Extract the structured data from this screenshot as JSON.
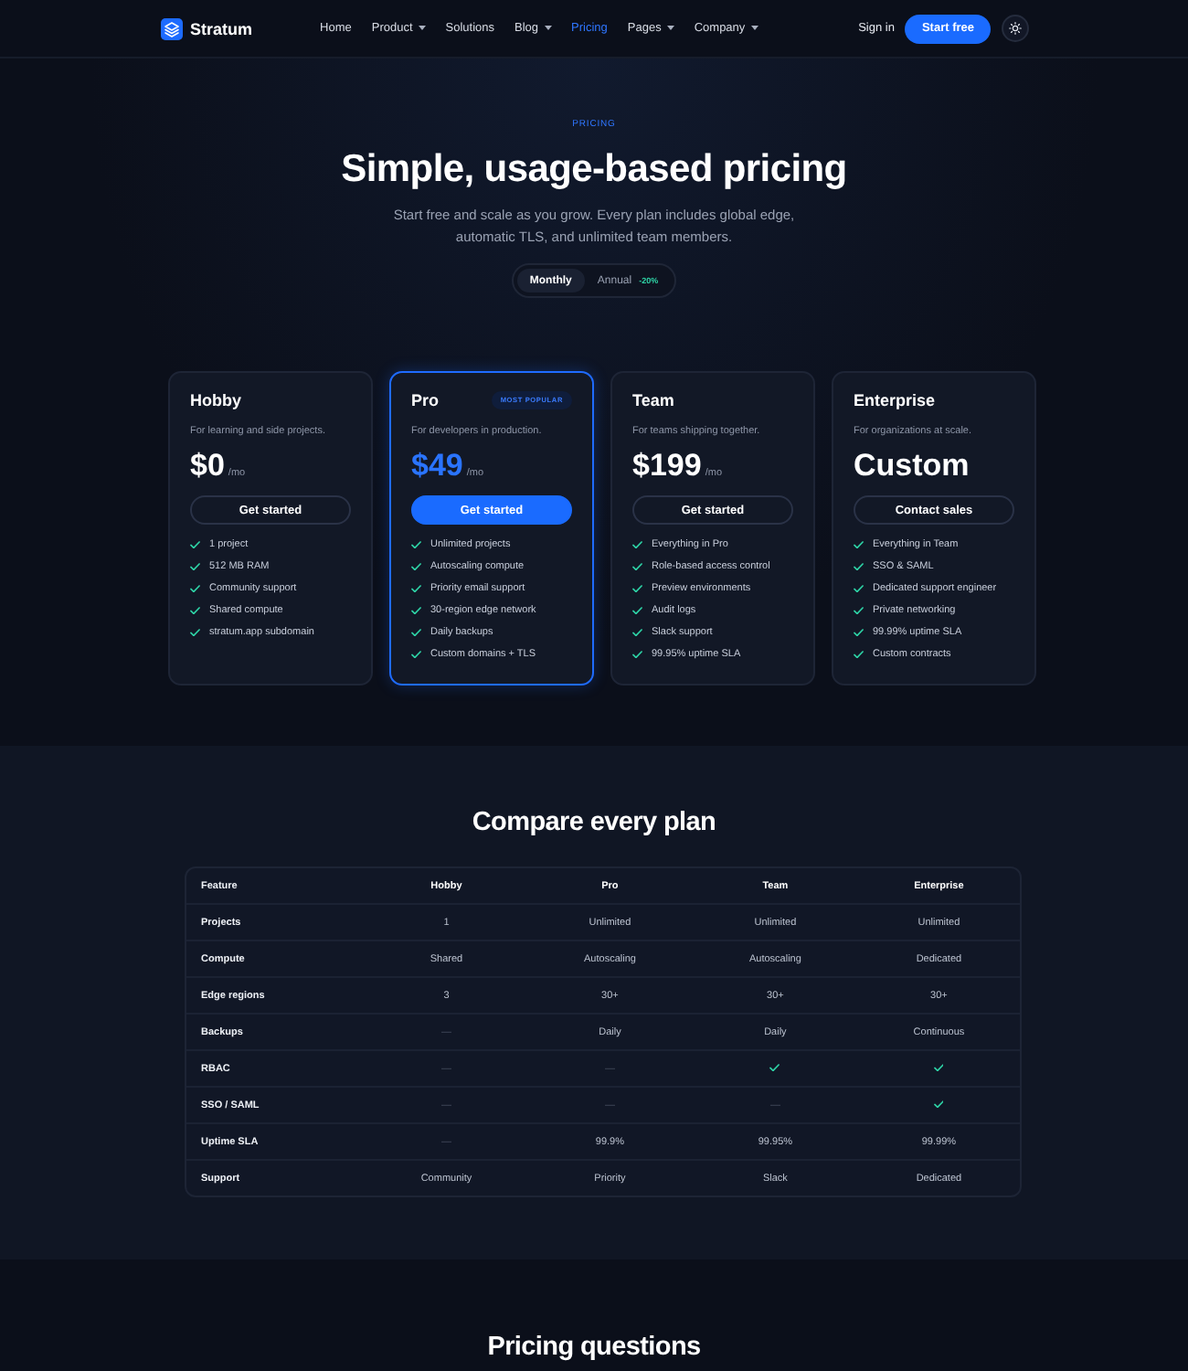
{
  "nav": {
    "brand": "Stratum",
    "links": [
      {
        "label": "Home",
        "selected": false,
        "dropdown": false
      },
      {
        "label": "Product",
        "selected": false,
        "dropdown": true
      },
      {
        "label": "Solutions",
        "selected": false,
        "dropdown": false
      },
      {
        "label": "Blog",
        "selected": false,
        "dropdown": true
      },
      {
        "label": "Pricing",
        "selected": true,
        "dropdown": false
      },
      {
        "label": "Pages",
        "selected": false,
        "dropdown": true
      },
      {
        "label": "Company",
        "selected": false,
        "dropdown": true
      }
    ],
    "sign_in": "Sign in",
    "cta": "Start free"
  },
  "hero": {
    "eyebrow": "PRICING",
    "title": "Simple, usage-based pricing",
    "subtitle": "Start free and scale as you grow. Every plan includes global edge, automatic TLS, and unlimited team members.",
    "billing": [
      {
        "label": "Monthly",
        "selected": true
      },
      {
        "label": "Annual",
        "selected": false,
        "discount": "-20%"
      }
    ]
  },
  "plans": [
    {
      "name": "Hobby",
      "featured": false,
      "description": "For learning and side projects.",
      "price": "$0",
      "period": "/mo",
      "button": "Get started",
      "features": [
        "1 project",
        "512 MB RAM",
        "Community support",
        "Shared compute",
        "stratum.app subdomain"
      ]
    },
    {
      "name": "Pro",
      "featured": true,
      "badge": "MOST POPULAR",
      "description": "For developers in production.",
      "price": "$49",
      "period": "/mo",
      "button": "Get started",
      "features": [
        "Unlimited projects",
        "Autoscaling compute",
        "Priority email support",
        "30-region edge network",
        "Daily backups",
        "Custom domains + TLS"
      ]
    },
    {
      "name": "Team",
      "featured": false,
      "description": "For teams shipping together.",
      "price": "$199",
      "period": "/mo",
      "button": "Get started",
      "features": [
        "Everything in Pro",
        "Role-based access control",
        "Preview environments",
        "Audit logs",
        "Slack support",
        "99.95% uptime SLA"
      ]
    },
    {
      "name": "Enterprise",
      "featured": false,
      "description": "For organizations at scale.",
      "price": "Custom",
      "button": "Contact sales",
      "features": [
        "Everything in Team",
        "SSO & SAML",
        "Dedicated support engineer",
        "Private networking",
        "99.99% uptime SLA",
        "Custom contracts"
      ]
    }
  ],
  "compare": {
    "title": "Compare every plan",
    "columns": [
      "Feature",
      "Hobby",
      "Pro",
      "Team",
      "Enterprise"
    ],
    "rows": [
      {
        "cells": [
          {
            "kind": "label",
            "text": "Projects"
          },
          {
            "kind": "text",
            "text": "1"
          },
          {
            "kind": "text",
            "text": "Unlimited"
          },
          {
            "kind": "text",
            "text": "Unlimited"
          },
          {
            "kind": "text",
            "text": "Unlimited"
          }
        ]
      },
      {
        "cells": [
          {
            "kind": "label",
            "text": "Compute"
          },
          {
            "kind": "text",
            "text": "Shared"
          },
          {
            "kind": "text",
            "text": "Autoscaling"
          },
          {
            "kind": "text",
            "text": "Autoscaling"
          },
          {
            "kind": "text",
            "text": "Dedicated"
          }
        ]
      },
      {
        "cells": [
          {
            "kind": "label",
            "text": "Edge regions"
          },
          {
            "kind": "text",
            "text": "3"
          },
          {
            "kind": "text",
            "text": "30+"
          },
          {
            "kind": "text",
            "text": "30+"
          },
          {
            "kind": "text",
            "text": "30+"
          }
        ]
      },
      {
        "cells": [
          {
            "kind": "label",
            "text": "Backups"
          },
          {
            "kind": "dash",
            "text": "—"
          },
          {
            "kind": "text",
            "text": "Daily"
          },
          {
            "kind": "text",
            "text": "Daily"
          },
          {
            "kind": "text",
            "text": "Continuous"
          }
        ]
      },
      {
        "cells": [
          {
            "kind": "label",
            "text": "RBAC"
          },
          {
            "kind": "dash",
            "text": "—"
          },
          {
            "kind": "dash",
            "text": "—"
          },
          {
            "kind": "check"
          },
          {
            "kind": "check"
          }
        ]
      },
      {
        "cells": [
          {
            "kind": "label",
            "text": "SSO / SAML"
          },
          {
            "kind": "dash",
            "text": "—"
          },
          {
            "kind": "dash",
            "text": "—"
          },
          {
            "kind": "dash",
            "text": "—"
          },
          {
            "kind": "check"
          }
        ]
      },
      {
        "cells": [
          {
            "kind": "label",
            "text": "Uptime SLA"
          },
          {
            "kind": "dash",
            "text": "—"
          },
          {
            "kind": "text",
            "text": "99.9%"
          },
          {
            "kind": "text",
            "text": "99.95%"
          },
          {
            "kind": "text",
            "text": "99.99%"
          }
        ]
      },
      {
        "cells": [
          {
            "kind": "label",
            "text": "Support"
          },
          {
            "kind": "text",
            "text": "Community"
          },
          {
            "kind": "text",
            "text": "Priority"
          },
          {
            "kind": "text",
            "text": "Slack"
          },
          {
            "kind": "text",
            "text": "Dedicated"
          }
        ]
      }
    ]
  },
  "faq": {
    "title": "Pricing questions"
  }
}
